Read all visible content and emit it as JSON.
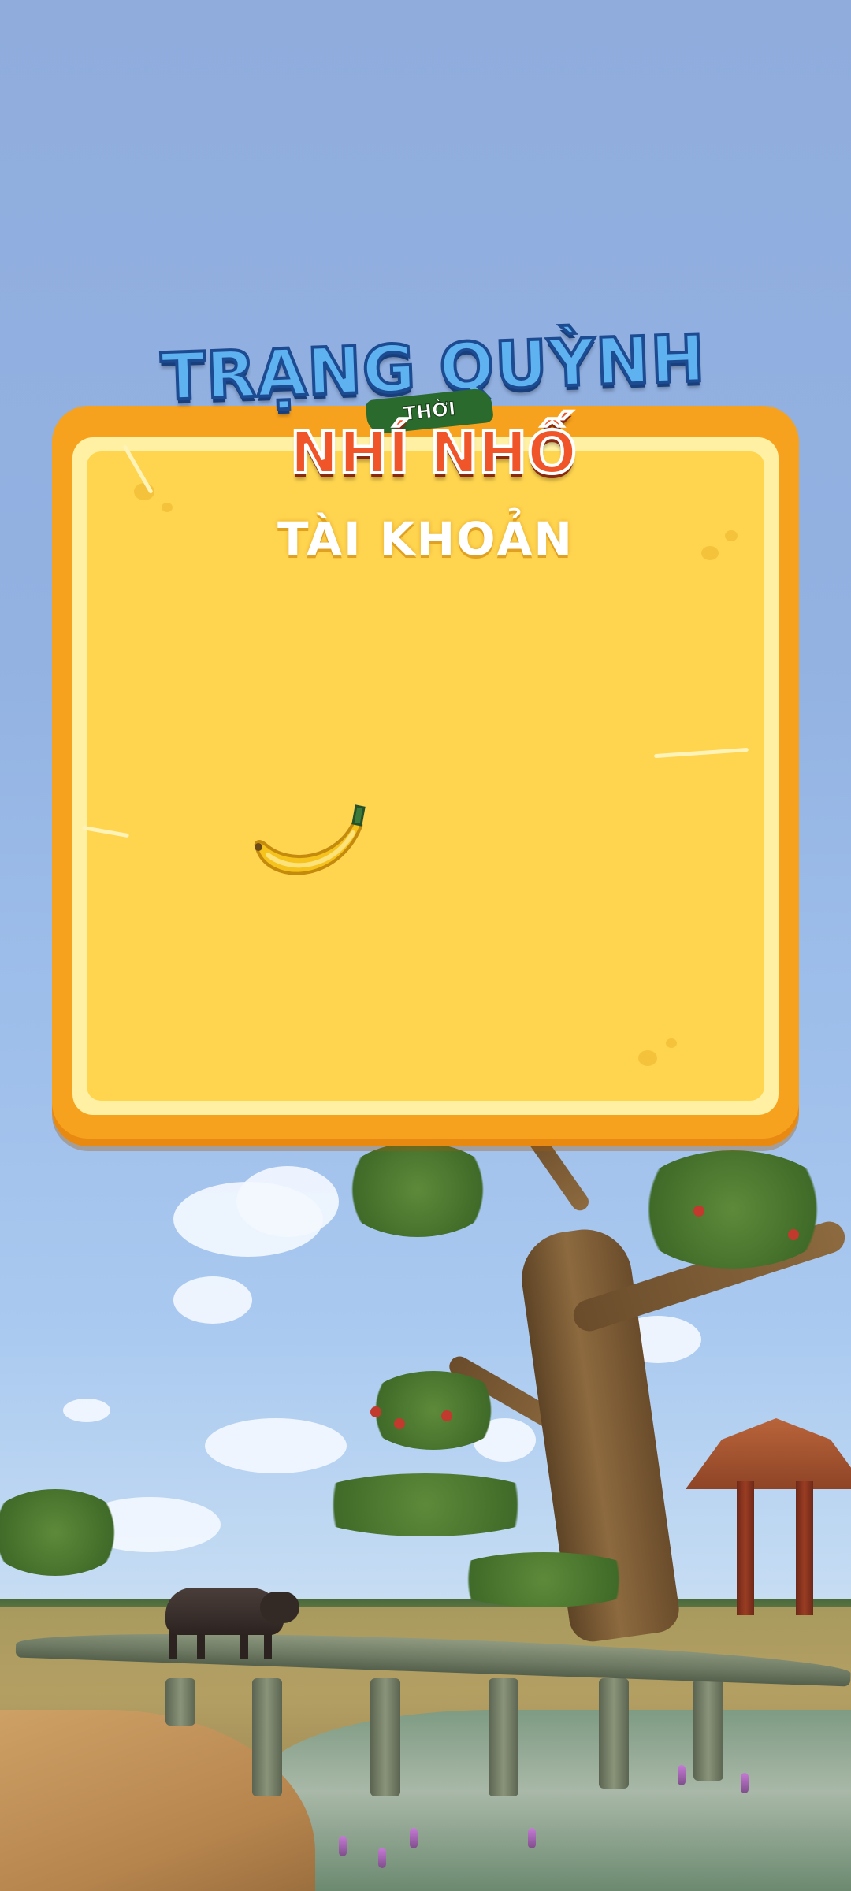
{
  "logo": {
    "line1": "TRẠNG QUỲNH",
    "sub": "THỜI",
    "line2": "NHÍ NHỐ"
  },
  "panel": {
    "title": "TÀI KHOẢN"
  },
  "icons": {
    "loading": "banana-icon"
  },
  "colors": {
    "panel_outer": "#f7a21e",
    "panel_inner": "#ffd54f",
    "logo_blue": "#5fb2f0",
    "logo_orange": "#f0552a",
    "sky": "#8facdd"
  }
}
